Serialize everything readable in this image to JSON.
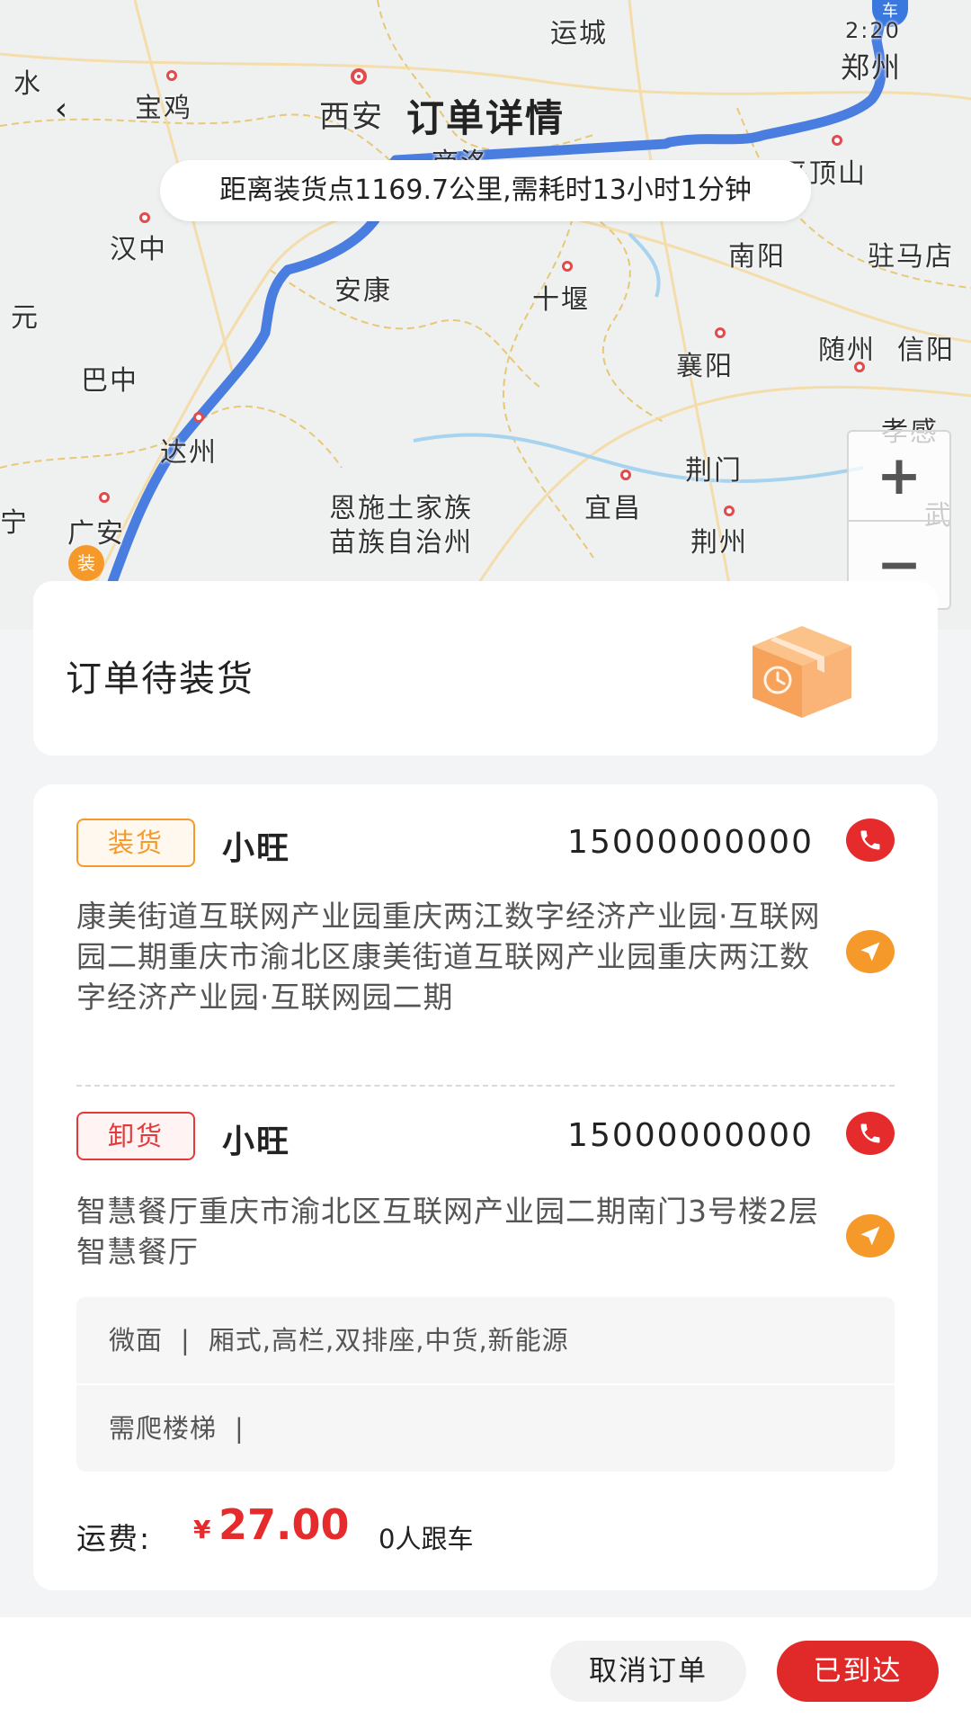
{
  "header": {
    "back_icon": "chevron-left-icon",
    "title": "订单详情"
  },
  "map": {
    "distance_text": "距离装货点1169.7公里,需耗时13小时1分钟",
    "zoom_in_label": "+",
    "zoom_out_label": "−",
    "truck_pin_label": "车",
    "truck_time_label": "2:20",
    "load_pin_label": "装",
    "route_color": "#4a7de0",
    "city_labels": {
      "zhengzhou": "郑州",
      "yuncheng": "运城",
      "baoji": "宝鸡",
      "xian": "西安",
      "shangluo": "商洛",
      "pingdingshan": "平顶山",
      "nanyang": "南阳",
      "zhumadian": "驻马店",
      "hanzhong": "汉中",
      "ankang": "安康",
      "shiyan": "十堰",
      "xiangyang": "襄阳",
      "suizhou": "随州",
      "xinyang": "信阳",
      "bazhong": "巴中",
      "dazhou": "达州",
      "xiaogan": "孝感",
      "jingmen": "荆门",
      "enshi_1": "恩施土家族",
      "enshi_2": "苗族自治州",
      "yichang": "宜昌",
      "jingzhou": "荆州",
      "guangan": "广安",
      "wuhan": "武",
      "guangyuan": "元",
      "shui": "水",
      "ning": "宁"
    }
  },
  "status": {
    "text": "订单待装货",
    "icon": "box-clock-icon"
  },
  "loading": {
    "tag": "装货",
    "name": "小旺",
    "phone": "15000000000",
    "address": "康美街道互联网产业园重庆两江数字经济产业园·互联网园二期重庆市渝北区康美街道互联网产业园重庆两江数字经济产业园·互联网园二期"
  },
  "unloading": {
    "tag": "卸货",
    "name": "小旺",
    "phone": "15000000000",
    "address": "智慧餐厅重庆市渝北区互联网产业园二期南门3号楼2层智慧餐厅"
  },
  "requirements": {
    "vehicle_type": "微面",
    "separator": "|",
    "vehicle_features": "厢式,高栏,双排座,中货,新能源",
    "extra": "需爬楼梯"
  },
  "fare": {
    "label": "运费:",
    "currency": "¥",
    "amount": "27.00",
    "followers": "0人跟车"
  },
  "actions": {
    "cancel": "取消订单",
    "arrived": "已到达"
  },
  "colors": {
    "primary_red": "#e02a2a",
    "load_orange": "#f59a2a"
  }
}
